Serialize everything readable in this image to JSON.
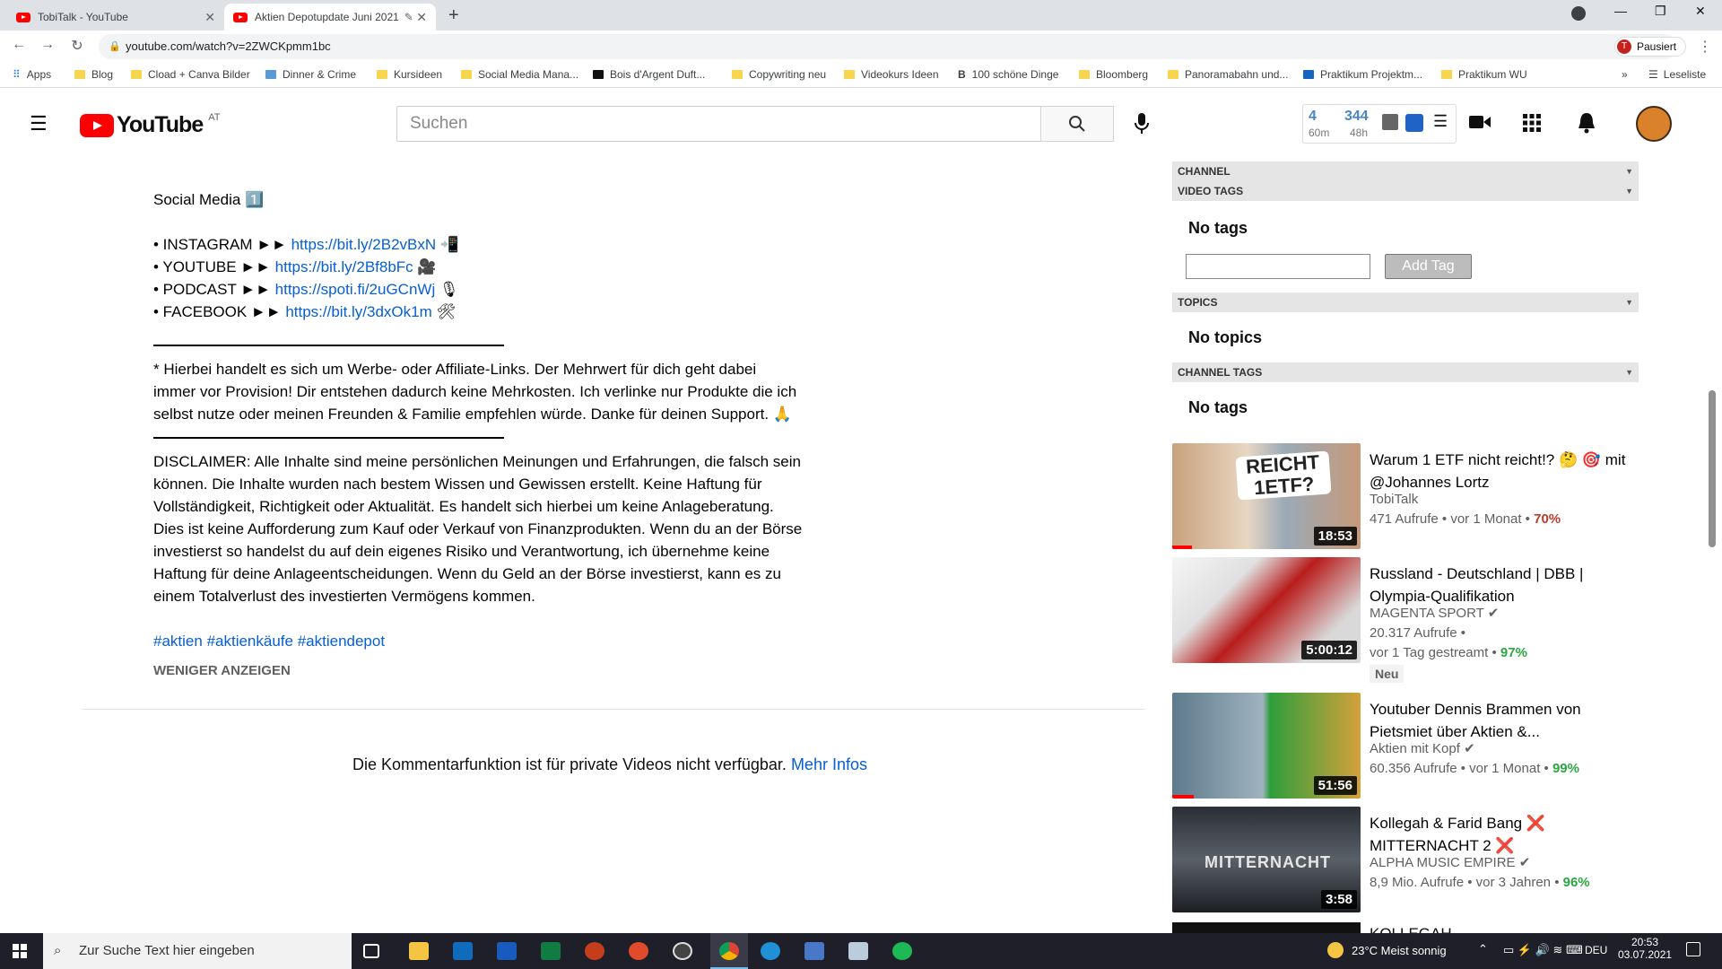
{
  "browser": {
    "tabs": [
      {
        "title": "TobiTalk - YouTube"
      },
      {
        "title": "Aktien Depotupdate Juni 2021"
      }
    ],
    "url": "youtube.com/watch?v=2ZWCKpmm1bc",
    "profile_label": "Pausiert",
    "profile_initial": "T",
    "bookmarks": [
      "Apps",
      "Blog",
      "Cload + Canva Bilder",
      "Dinner & Crime",
      "Kursideen",
      "Social Media Mana...",
      "Bois d'Argent Duft...",
      "Copywriting neu",
      "Videokurs Ideen",
      "100 schöne Dinge",
      "Bloomberg",
      "Panoramabahn und...",
      "Praktikum Projektm...",
      "Praktikum WU"
    ],
    "reading_list": "Leseliste"
  },
  "youtube": {
    "logo": "YouTube",
    "country": "AT",
    "search_placeholder": "Suchen",
    "stats": {
      "a": "4",
      "a_sub": "60m",
      "b": "344",
      "b_sub": "48h"
    }
  },
  "description": {
    "heading": "Social Media",
    "heading_emoji": "1️⃣",
    "socials": [
      {
        "label": "• INSTAGRAM ►►",
        "link": "https://bit.ly/2B2vBxN",
        "emoji": "📲"
      },
      {
        "label": "• YOUTUBE ►►",
        "link": "https://bit.ly/2Bf8bFc",
        "emoji": "🎥"
      },
      {
        "label": "• PODCAST ►►",
        "link": "https://spoti.fi/2uGCnWj",
        "emoji": "🎙"
      },
      {
        "label": "• FACEBOOK ►►",
        "link": "https://bit.ly/3dxOk1m",
        "emoji": "🛠"
      }
    ],
    "affiliate_lines": [
      "* Hierbei handelt es sich um Werbe- oder Affiliate-Links. Der Mehrwert für dich geht dabei",
      "immer vor Provision! Dir entstehen dadurch keine Mehrkosten. Ich verlinke nur Produkte die ich",
      "selbst nutze oder meinen Freunden & Familie empfehlen würde. Danke für deinen Support. 🙏"
    ],
    "disclaimer_lines": [
      "DISCLAIMER: Alle Inhalte sind meine persönlichen Meinungen und Erfahrungen, die falsch sein",
      "können. Die Inhalte wurden nach bestem Wissen und Gewissen erstellt. Keine Haftung für",
      "Vollständigkeit, Richtigkeit oder Aktualität. Es handelt sich hierbei um keine Anlageberatung.",
      "Dies ist keine Aufforderung zum Kauf oder Verkauf von Finanzprodukten. Wenn du an der Börse",
      "investierst so handelst du auf dein eigenes Risiko und Verantwortung, ich übernehme keine",
      "Haftung für deine Anlageentscheidungen. Wenn du Geld an der Börse investierst, kann es zu",
      "einem Totalverlust des investierten Vermögens kommen."
    ],
    "hashtags": [
      "#aktien",
      "#aktienkäufe",
      "#aktiendepot"
    ],
    "show_less": "WENIGER ANZEIGEN",
    "comments_disabled": "Die Kommentarfunktion ist für private Videos nicht verfügbar.",
    "more_info": "Mehr Infos"
  },
  "panel": {
    "channel": "CHANNEL",
    "video_tags": "VIDEO TAGS",
    "no_tags": "No tags",
    "add_tag": "Add Tag",
    "topics": "TOPICS",
    "no_topics": "No topics",
    "channel_tags": "CHANNEL TAGS",
    "no_channel_tags": "No tags"
  },
  "recommendations": [
    {
      "title": "Warum 1 ETF nicht reicht!? 🤔 🎯 mit @Johannes Lortz",
      "channel": "TobiTalk",
      "meta": "471 Aufrufe • vor 1 Monat •",
      "pct": "70%",
      "duration": "18:53",
      "thumb_text": "REICHT 1ETF?"
    },
    {
      "title": "Russland - Deutschland | DBB | Olympia-Qualifikation",
      "channel": "MAGENTA SPORT",
      "meta": "20.317 Aufrufe •",
      "meta2": "vor 1 Tag gestreamt •",
      "pct": "97%",
      "badge": "Neu",
      "duration": "5:00:12"
    },
    {
      "title": "Youtuber Dennis Brammen von Pietsmiet über Aktien &...",
      "channel": "Aktien mit Kopf",
      "meta": "60.356 Aufrufe • vor 1 Monat •",
      "pct": "99%",
      "duration": "51:56"
    },
    {
      "title": "Kollegah & Farid Bang ❌ MITTERNACHT 2 ❌",
      "channel": "ALPHA MUSIC EMPIRE",
      "meta": "8,9 Mio. Aufrufe • vor 3 Jahren •",
      "pct": "96%",
      "duration": "3:58",
      "thumb_text": "MITTERNACHT"
    },
    {
      "title": "KOLLEGAH",
      "channel": "",
      "meta": "",
      "pct": "",
      "duration": ""
    }
  ],
  "taskbar": {
    "search_placeholder": "Zur Suche Text hier eingeben",
    "weather": "23°C  Meist sonnig",
    "lang": "DEU",
    "time": "20:53",
    "date": "03.07.2021"
  }
}
